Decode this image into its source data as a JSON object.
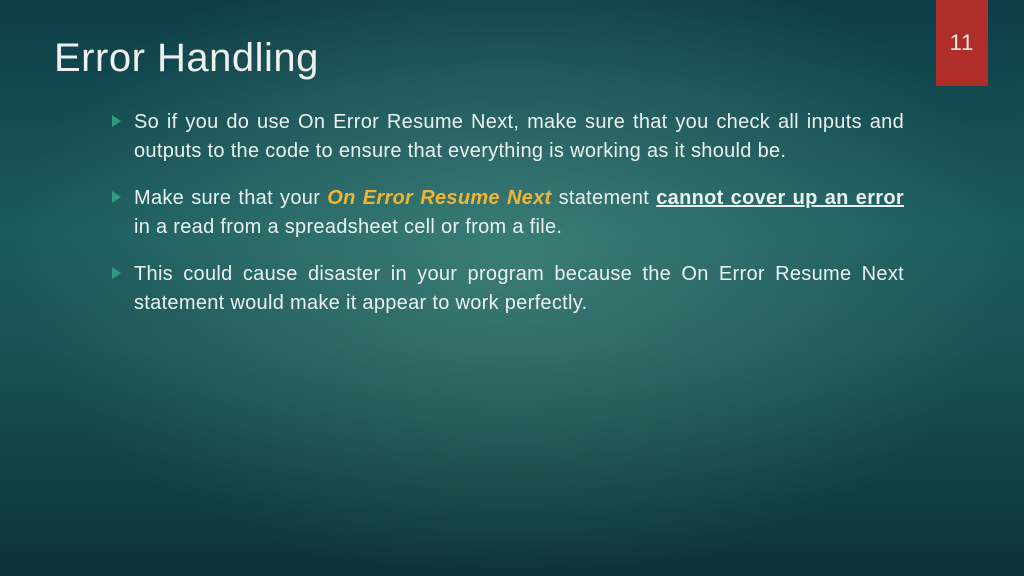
{
  "slide": {
    "number": "11",
    "title": "Error Handling",
    "bullets": [
      {
        "pre": "So if you do use On Error Resume Next, make sure that you check all inputs and outputs to the code to ensure that everything is working as it should be."
      },
      {
        "pre": "Make sure that your ",
        "hl": "On Error Resume Next",
        "mid": " statement ",
        "ul": "cannot cover up an error",
        "post": " in a read from a spreadsheet cell or from a file."
      },
      {
        "pre": "This could cause disaster in your program because the On Error Resume Next statement would make it appear to work perfectly."
      }
    ]
  }
}
